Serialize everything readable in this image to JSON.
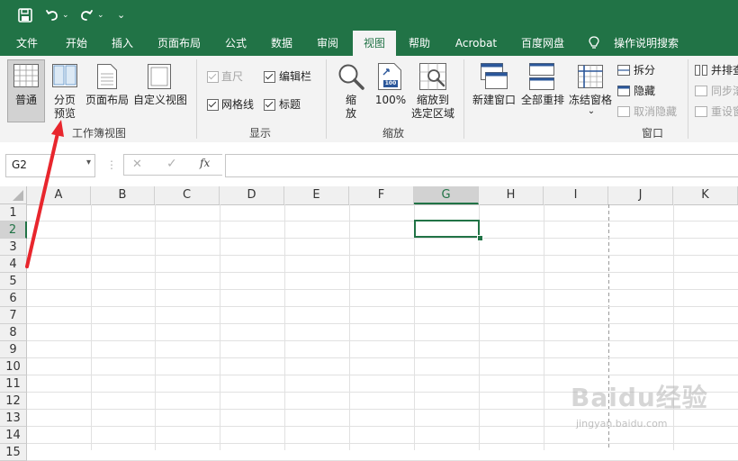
{
  "quick_access": {
    "save_icon": "save-icon",
    "undo_icon": "undo-icon",
    "redo_icon": "redo-icon",
    "customize_icon": "customize-icon"
  },
  "tabs": [
    {
      "label": "文件"
    },
    {
      "label": "开始"
    },
    {
      "label": "插入"
    },
    {
      "label": "页面布局"
    },
    {
      "label": "公式"
    },
    {
      "label": "数据"
    },
    {
      "label": "审阅"
    },
    {
      "label": "视图",
      "active": true
    },
    {
      "label": "帮助"
    },
    {
      "label": "Acrobat"
    },
    {
      "label": "百度网盘"
    }
  ],
  "tell_me": {
    "label": "操作说明搜索",
    "icon": "lightbulb-icon"
  },
  "ribbon": {
    "workbook_views": {
      "group_label": "工作簿视图",
      "normal": "普通",
      "page_break_1": "分页",
      "page_break_2": "预览",
      "page_layout": "页面布局",
      "custom_views": "自定义视图"
    },
    "show": {
      "group_label": "显示",
      "ruler": "直尺",
      "formula_bar": "编辑栏",
      "gridlines": "网格线",
      "headings": "标题",
      "ruler_checked": true,
      "formula_bar_checked": true,
      "gridlines_checked": true,
      "headings_checked": true
    },
    "zoom": {
      "group_label": "缩放",
      "zoom_1": "缩",
      "zoom_2": "放",
      "zoom_100": "100%",
      "zoom_sel_1": "缩放到",
      "zoom_sel_2": "选定区域",
      "badge": "100"
    },
    "window": {
      "group_label": "窗口",
      "new_window": "新建窗口",
      "arrange_all": "全部重排",
      "freeze_panes": "冻结窗格",
      "freeze_caret": "⌄",
      "split": "拆分",
      "hide": "隐藏",
      "unhide": "取消隐藏",
      "side_by_side": "并排查",
      "sync_scroll": "同步滚",
      "reset_position": "重设窗"
    }
  },
  "formula_bar": {
    "name_box": "G2",
    "cancel": "✕",
    "enter": "✓",
    "fx": "fx",
    "value": ""
  },
  "sheet": {
    "columns": [
      "A",
      "B",
      "C",
      "D",
      "E",
      "F",
      "G",
      "H",
      "I",
      "J",
      "K"
    ],
    "rows": [
      "1",
      "2",
      "3",
      "4",
      "5",
      "6",
      "7",
      "8",
      "9",
      "10",
      "11",
      "12",
      "13",
      "14",
      "15"
    ],
    "selected_col": "G",
    "selected_row": "2",
    "active_cell": "G2"
  },
  "annotation": {
    "color": "#e8262d"
  },
  "watermark": {
    "line1": "Baidu经验",
    "line2": "jingyan.baidu.com"
  }
}
